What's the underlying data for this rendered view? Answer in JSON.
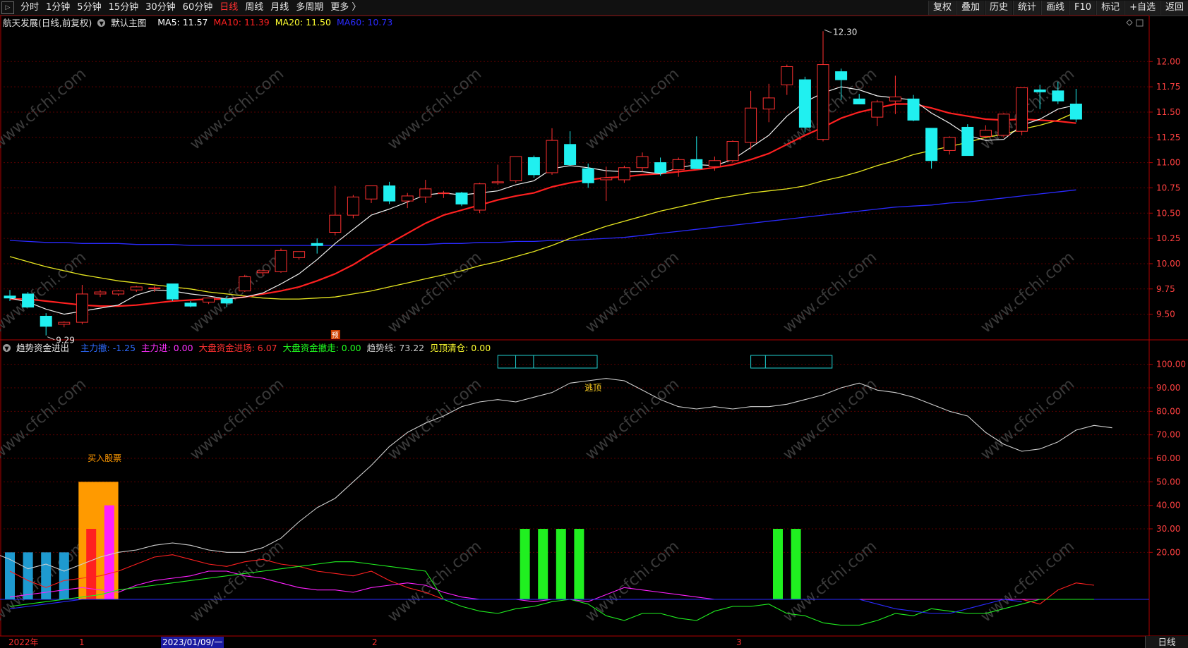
{
  "toolbar": {
    "periods": [
      "分时",
      "1分钟",
      "5分钟",
      "15分钟",
      "30分钟",
      "60分钟",
      "日线",
      "周线",
      "月线",
      "多周期",
      "更多 〉"
    ],
    "active_period": "日线",
    "actions": [
      "复权",
      "叠加",
      "历史",
      "统计",
      "画线",
      "F10",
      "标记",
      "+自选",
      "返回"
    ]
  },
  "main_panel": {
    "stock_label": "航天发展(日线,前复权)",
    "template_label": "默认主图",
    "ma": [
      {
        "label": "MA5: 11.57",
        "color": "#ffffff"
      },
      {
        "label": "MA10: 11.39",
        "color": "#ff2020"
      },
      {
        "label": "MA20: 11.50",
        "color": "#ffff30"
      },
      {
        "label": "MA60: 10.73",
        "color": "#2a2aff"
      }
    ],
    "high_label": "12.30",
    "low_label": "9.29",
    "marker_label": "预",
    "y_ticks": [
      "12.00",
      "11.75",
      "11.50",
      "11.25",
      "11.00",
      "10.75",
      "10.50",
      "10.25",
      "10.00",
      "9.75",
      "9.50"
    ]
  },
  "indicator_panel": {
    "name": "趋势资金进出",
    "values": [
      {
        "label": "主力撤: -1.25",
        "color": "#2e6bff"
      },
      {
        "label": "主力进: 0.00",
        "color": "#ff30ff"
      },
      {
        "label": "大盘资金进场: 6.07",
        "color": "#ff3030"
      },
      {
        "label": "大盘资金撤走: 0.00",
        "color": "#20ff20"
      },
      {
        "label": "趋势线: 73.22",
        "color": "#cccccc"
      },
      {
        "label": "见顶清仓: 0.00",
        "color": "#ffff30"
      }
    ],
    "buy_label": "买入股票",
    "escape_label": "逃顶",
    "y_ticks": [
      "100.00",
      "90.00",
      "80.00",
      "70.00",
      "60.00",
      "50.00",
      "40.00",
      "30.00",
      "20.00"
    ]
  },
  "watermark": "www.cfchi.com",
  "date_axis": {
    "labels": [
      "2022年",
      "1",
      "2023/01/09/一",
      "2",
      "3"
    ],
    "period_button": "日线"
  },
  "chart_data": {
    "type": "candlestick",
    "series_name": "航天发展",
    "candles": [
      {
        "o": 9.68,
        "h": 9.74,
        "l": 9.63,
        "c": 9.66
      },
      {
        "o": 9.7,
        "h": 9.72,
        "l": 9.57,
        "c": 9.57
      },
      {
        "o": 9.48,
        "h": 9.51,
        "l": 9.29,
        "c": 9.38
      },
      {
        "o": 9.4,
        "h": 9.43,
        "l": 9.37,
        "c": 9.42
      },
      {
        "o": 9.42,
        "h": 9.79,
        "l": 9.4,
        "c": 9.7
      },
      {
        "o": 9.7,
        "h": 9.74,
        "l": 9.67,
        "c": 9.72
      },
      {
        "o": 9.7,
        "h": 9.74,
        "l": 9.68,
        "c": 9.73
      },
      {
        "o": 9.74,
        "h": 9.78,
        "l": 9.72,
        "c": 9.77
      },
      {
        "o": 9.76,
        "h": 9.78,
        "l": 9.72,
        "c": 9.76
      },
      {
        "o": 9.8,
        "h": 9.8,
        "l": 9.63,
        "c": 9.65
      },
      {
        "o": 9.61,
        "h": 9.63,
        "l": 9.57,
        "c": 9.58
      },
      {
        "o": 9.62,
        "h": 9.66,
        "l": 9.6,
        "c": 9.66
      },
      {
        "o": 9.65,
        "h": 9.68,
        "l": 9.57,
        "c": 9.61
      },
      {
        "o": 9.73,
        "h": 9.89,
        "l": 9.72,
        "c": 9.87
      },
      {
        "o": 9.91,
        "h": 9.94,
        "l": 9.88,
        "c": 9.93
      },
      {
        "o": 9.92,
        "h": 10.15,
        "l": 9.91,
        "c": 10.13
      },
      {
        "o": 10.06,
        "h": 10.12,
        "l": 10.04,
        "c": 10.12
      },
      {
        "o": 10.2,
        "h": 10.25,
        "l": 10.1,
        "c": 10.18
      },
      {
        "o": 10.31,
        "h": 10.77,
        "l": 10.28,
        "c": 10.48
      },
      {
        "o": 10.48,
        "h": 10.68,
        "l": 10.45,
        "c": 10.66
      },
      {
        "o": 10.64,
        "h": 10.77,
        "l": 10.6,
        "c": 10.77
      },
      {
        "o": 10.77,
        "h": 10.81,
        "l": 10.59,
        "c": 10.62
      },
      {
        "o": 10.62,
        "h": 10.7,
        "l": 10.55,
        "c": 10.67
      },
      {
        "o": 10.66,
        "h": 10.83,
        "l": 10.6,
        "c": 10.74
      },
      {
        "o": 10.7,
        "h": 10.72,
        "l": 10.65,
        "c": 10.7
      },
      {
        "o": 10.7,
        "h": 10.71,
        "l": 10.57,
        "c": 10.59
      },
      {
        "o": 10.53,
        "h": 10.8,
        "l": 10.5,
        "c": 10.79
      },
      {
        "o": 10.8,
        "h": 10.98,
        "l": 10.78,
        "c": 10.81
      },
      {
        "o": 10.82,
        "h": 11.06,
        "l": 10.8,
        "c": 11.06
      },
      {
        "o": 11.05,
        "h": 11.07,
        "l": 10.85,
        "c": 10.88
      },
      {
        "o": 10.9,
        "h": 11.34,
        "l": 10.88,
        "c": 11.22
      },
      {
        "o": 11.18,
        "h": 11.31,
        "l": 10.97,
        "c": 10.98
      },
      {
        "o": 10.94,
        "h": 10.99,
        "l": 10.75,
        "c": 10.8
      },
      {
        "o": 10.83,
        "h": 10.96,
        "l": 10.62,
        "c": 10.85
      },
      {
        "o": 10.83,
        "h": 10.97,
        "l": 10.8,
        "c": 10.95
      },
      {
        "o": 10.95,
        "h": 11.1,
        "l": 10.91,
        "c": 11.06
      },
      {
        "o": 11.0,
        "h": 11.05,
        "l": 10.87,
        "c": 10.9
      },
      {
        "o": 10.93,
        "h": 11.05,
        "l": 10.86,
        "c": 11.03
      },
      {
        "o": 11.03,
        "h": 11.26,
        "l": 10.95,
        "c": 10.94
      },
      {
        "o": 10.96,
        "h": 11.06,
        "l": 10.92,
        "c": 11.02
      },
      {
        "o": 11.02,
        "h": 11.22,
        "l": 11.0,
        "c": 11.21
      },
      {
        "o": 11.2,
        "h": 11.71,
        "l": 11.13,
        "c": 11.54
      },
      {
        "o": 11.53,
        "h": 11.78,
        "l": 11.4,
        "c": 11.64
      },
      {
        "o": 11.77,
        "h": 11.97,
        "l": 11.67,
        "c": 11.95
      },
      {
        "o": 11.82,
        "h": 11.85,
        "l": 11.3,
        "c": 11.35
      },
      {
        "o": 11.23,
        "h": 12.3,
        "l": 11.21,
        "c": 11.97
      },
      {
        "o": 11.9,
        "h": 11.93,
        "l": 11.62,
        "c": 11.82
      },
      {
        "o": 11.63,
        "h": 11.68,
        "l": 11.58,
        "c": 11.58
      },
      {
        "o": 11.45,
        "h": 11.62,
        "l": 11.36,
        "c": 11.6
      },
      {
        "o": 11.61,
        "h": 11.86,
        "l": 11.48,
        "c": 11.65
      },
      {
        "o": 11.63,
        "h": 11.67,
        "l": 11.41,
        "c": 11.42
      },
      {
        "o": 11.34,
        "h": 11.34,
        "l": 10.94,
        "c": 11.02
      },
      {
        "o": 11.12,
        "h": 11.26,
        "l": 11.08,
        "c": 11.25
      },
      {
        "o": 11.35,
        "h": 11.38,
        "l": 11.07,
        "c": 11.07
      },
      {
        "o": 11.26,
        "h": 11.37,
        "l": 11.24,
        "c": 11.32
      },
      {
        "o": 11.27,
        "h": 11.49,
        "l": 11.25,
        "c": 11.48
      },
      {
        "o": 11.31,
        "h": 11.74,
        "l": 11.27,
        "c": 11.74
      },
      {
        "o": 11.72,
        "h": 11.77,
        "l": 11.53,
        "c": 11.7
      },
      {
        "o": 11.71,
        "h": 11.8,
        "l": 11.58,
        "c": 11.61
      },
      {
        "o": 11.58,
        "h": 11.73,
        "l": 11.4,
        "c": 11.43
      }
    ],
    "ma5": [
      9.66,
      9.62,
      9.55,
      9.5,
      9.53,
      9.56,
      9.59,
      9.69,
      9.74,
      9.73,
      9.7,
      9.68,
      9.65,
      9.67,
      9.71,
      9.8,
      9.9,
      10.04,
      10.2,
      10.34,
      10.48,
      10.54,
      10.61,
      10.68,
      10.7,
      10.68,
      10.7,
      10.72,
      10.78,
      10.82,
      10.94,
      10.97,
      10.95,
      10.92,
      10.91,
      10.91,
      10.89,
      10.95,
      10.98,
      10.97,
      11.03,
      11.15,
      11.27,
      11.46,
      11.6,
      11.69,
      11.75,
      11.72,
      11.66,
      11.64,
      11.62,
      11.49,
      11.39,
      11.27,
      11.22,
      11.23,
      11.37,
      11.43,
      11.53,
      11.57
    ],
    "ma10": [
      9.65,
      9.65,
      9.63,
      9.61,
      9.59,
      9.58,
      9.58,
      9.59,
      9.61,
      9.63,
      9.64,
      9.65,
      9.65,
      9.67,
      9.7,
      9.73,
      9.77,
      9.83,
      9.9,
      9.99,
      10.1,
      10.2,
      10.3,
      10.4,
      10.48,
      10.53,
      10.58,
      10.63,
      10.67,
      10.7,
      10.76,
      10.8,
      10.83,
      10.85,
      10.86,
      10.88,
      10.89,
      10.91,
      10.93,
      10.95,
      10.98,
      11.03,
      11.09,
      11.18,
      11.27,
      11.35,
      11.44,
      11.5,
      11.54,
      11.58,
      11.58,
      11.54,
      11.49,
      11.46,
      11.43,
      11.42,
      11.43,
      11.42,
      11.41,
      11.39
    ],
    "ma20": [
      10.07,
      10.02,
      9.97,
      9.93,
      9.89,
      9.86,
      9.83,
      9.81,
      9.79,
      9.77,
      9.75,
      9.72,
      9.7,
      9.68,
      9.66,
      9.65,
      9.65,
      9.66,
      9.67,
      9.7,
      9.73,
      9.77,
      9.81,
      9.85,
      9.89,
      9.93,
      9.98,
      10.02,
      10.07,
      10.12,
      10.18,
      10.25,
      10.31,
      10.37,
      10.42,
      10.47,
      10.52,
      10.56,
      10.6,
      10.64,
      10.67,
      10.7,
      10.72,
      10.74,
      10.77,
      10.82,
      10.86,
      10.91,
      10.97,
      11.02,
      11.08,
      11.12,
      11.16,
      11.2,
      11.25,
      11.28,
      11.33,
      11.37,
      11.42,
      11.5
    ],
    "ma60": [
      10.23,
      10.22,
      10.21,
      10.21,
      10.2,
      10.2,
      10.2,
      10.19,
      10.19,
      10.19,
      10.18,
      10.18,
      10.18,
      10.18,
      10.18,
      10.18,
      10.18,
      10.18,
      10.18,
      10.18,
      10.18,
      10.19,
      10.19,
      10.19,
      10.2,
      10.2,
      10.21,
      10.21,
      10.22,
      10.22,
      10.23,
      10.23,
      10.24,
      10.25,
      10.26,
      10.28,
      10.3,
      10.32,
      10.34,
      10.36,
      10.38,
      10.4,
      10.42,
      10.44,
      10.46,
      10.48,
      10.5,
      10.52,
      10.54,
      10.56,
      10.57,
      10.58,
      10.6,
      10.61,
      10.63,
      10.65,
      10.67,
      10.69,
      10.71,
      10.73
    ],
    "trend_line": [
      20,
      17,
      13,
      15,
      12,
      15,
      18,
      20,
      21,
      23,
      24,
      23,
      21,
      20,
      20,
      22,
      26,
      33,
      39,
      43,
      50,
      57,
      65,
      71,
      75,
      78,
      82,
      84,
      85,
      84,
      86,
      88,
      92,
      93,
      94,
      93,
      89,
      85,
      82,
      81,
      82,
      81,
      82,
      82,
      83,
      85,
      87,
      90,
      92,
      89,
      88,
      86,
      83,
      80,
      78,
      71,
      66,
      63,
      64,
      67,
      72,
      74,
      73
    ],
    "red_line": [
      12,
      8,
      5,
      8,
      9,
      10,
      12,
      15,
      18,
      19,
      17,
      15,
      14,
      16,
      17,
      15,
      14,
      12,
      11,
      10,
      12,
      8,
      5,
      3,
      0,
      0,
      0,
      0,
      0,
      0,
      0,
      0,
      0,
      0,
      0,
      0,
      0,
      0,
      0,
      0,
      0,
      0,
      0,
      0,
      0,
      0,
      0,
      0,
      0,
      0,
      0,
      0,
      0,
      0,
      0,
      0,
      0,
      -2,
      4,
      7,
      6
    ],
    "magenta_line": [
      1,
      2,
      3,
      4,
      5,
      4,
      3,
      6,
      8,
      9,
      10,
      12,
      12,
      10,
      9,
      7,
      5,
      4,
      4,
      3,
      5,
      6,
      7,
      6,
      3,
      1,
      0,
      0,
      0,
      -1,
      0,
      0,
      -1,
      2,
      5,
      4,
      3,
      2,
      1,
      0,
      0,
      0,
      0,
      0,
      0,
      0,
      0,
      0,
      0,
      0,
      0,
      0,
      0,
      0,
      0,
      0,
      0,
      0,
      0,
      0,
      0
    ],
    "green_line": [
      -3,
      -2,
      -1,
      0,
      1,
      2,
      4,
      5,
      6,
      7,
      8,
      9,
      10,
      11,
      12,
      13,
      14,
      15,
      16,
      16,
      15,
      14,
      13,
      12,
      0,
      -3,
      -5,
      -6,
      -4,
      -3,
      -1,
      0,
      -2,
      -7,
      -9,
      -6,
      -6,
      -8,
      -9,
      -5,
      -3,
      -3,
      -2,
      -6,
      -7,
      -10,
      -11,
      -11,
      -9,
      -6,
      -7,
      -4,
      -5,
      -6,
      -6,
      -4,
      -2,
      0,
      0,
      0,
      0
    ],
    "blue_line": [
      -4,
      -3,
      -2,
      -1,
      0,
      0,
      0,
      0,
      0,
      0,
      0,
      0,
      0,
      0,
      0,
      0,
      0,
      0,
      0,
      0,
      0,
      0,
      0,
      0,
      0,
      0,
      0,
      0,
      0,
      0,
      0,
      0,
      0,
      0,
      0,
      0,
      0,
      0,
      0,
      0,
      0,
      0,
      0,
      0,
      0,
      0,
      0,
      0,
      -2,
      -4,
      -5,
      -6,
      -6,
      -4,
      -2,
      0,
      -1
    ],
    "cyan_bars": [
      {
        "i": 0,
        "v": 20
      },
      {
        "i": 1,
        "v": 20
      },
      {
        "i": 2,
        "v": 20
      },
      {
        "i": 3,
        "v": 20
      }
    ],
    "orange_bar": {
      "i_start": 3.8,
      "i_end": 6,
      "v": 50
    },
    "red_bars": [
      {
        "i": 4.5,
        "v": 30
      }
    ],
    "magenta_bars": [
      {
        "i": 5.5,
        "v": 40
      }
    ],
    "green_bars": [
      {
        "i": 28.5,
        "v": 30
      },
      {
        "i": 29.5,
        "v": 30
      },
      {
        "i": 30.5,
        "v": 30
      },
      {
        "i": 31.5,
        "v": 30
      },
      {
        "i": 42.5,
        "v": 30
      },
      {
        "i": 43.5,
        "v": 30
      }
    ],
    "top_boxes": [
      {
        "i_start": 27,
        "i_end": 32.5
      },
      {
        "i_start": 41,
        "i_end": 45.5
      }
    ],
    "price_ylim": [
      9.26,
      12.33
    ],
    "ind_ylim": [
      -15,
      105
    ]
  }
}
